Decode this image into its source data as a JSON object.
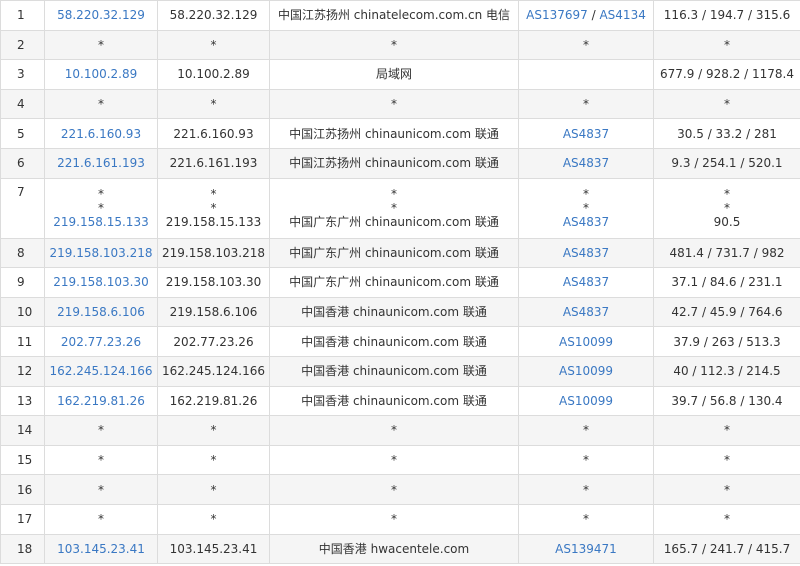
{
  "rows": [
    {
      "hop": "1",
      "ip_link": "58.220.32.129",
      "ip": "58.220.32.129",
      "location": "中国江苏扬州 chinatelecom.com.cn 电信",
      "as": [
        "AS137697",
        "AS4134"
      ],
      "times": "116.3 / 194.7 / 315.6"
    },
    {
      "hop": "2",
      "ip_link": "*",
      "ip": "*",
      "location": "*",
      "as": [
        "*"
      ],
      "times": "*"
    },
    {
      "hop": "3",
      "ip_link": "10.100.2.89",
      "ip": "10.100.2.89",
      "location": "局域网",
      "as": [],
      "times": "677.9 / 928.2 / 1178.4"
    },
    {
      "hop": "4",
      "ip_link": "*",
      "ip": "*",
      "location": "*",
      "as": [
        "*"
      ],
      "times": "*"
    },
    {
      "hop": "5",
      "ip_link": "221.6.160.93",
      "ip": "221.6.160.93",
      "location": "中国江苏扬州 chinaunicom.com 联通",
      "as": [
        "AS4837"
      ],
      "times": "30.5 / 33.2 / 281"
    },
    {
      "hop": "6",
      "ip_link": "221.6.161.193",
      "ip": "221.6.161.193",
      "location": "中国江苏扬州 chinaunicom.com 联通",
      "as": [
        "AS4837"
      ],
      "times": "9.3 / 254.1 / 520.1"
    },
    {
      "hop": "7",
      "multi": true,
      "ip_link_lines": [
        "*",
        "*",
        "219.158.15.133"
      ],
      "ip_lines": [
        "*",
        "*",
        "219.158.15.133"
      ],
      "location_lines": [
        "*",
        "*",
        "中国广东广州 chinaunicom.com 联通"
      ],
      "as_lines": [
        "*",
        "*",
        "AS4837"
      ],
      "times_lines": [
        "*",
        "*",
        "90.5"
      ]
    },
    {
      "hop": "8",
      "ip_link": "219.158.103.218",
      "ip": "219.158.103.218",
      "location": "中国广东广州 chinaunicom.com 联通",
      "as": [
        "AS4837"
      ],
      "times": "481.4 / 731.7 / 982"
    },
    {
      "hop": "9",
      "ip_link": "219.158.103.30",
      "ip": "219.158.103.30",
      "location": "中国广东广州 chinaunicom.com 联通",
      "as": [
        "AS4837"
      ],
      "times": "37.1 / 84.6 / 231.1"
    },
    {
      "hop": "10",
      "ip_link": "219.158.6.106",
      "ip": "219.158.6.106",
      "location": "中国香港 chinaunicom.com 联通",
      "as": [
        "AS4837"
      ],
      "times": "42.7 / 45.9 / 764.6"
    },
    {
      "hop": "11",
      "ip_link": "202.77.23.26",
      "ip": "202.77.23.26",
      "location": "中国香港 chinaunicom.com 联通",
      "as": [
        "AS10099"
      ],
      "times": "37.9 / 263 / 513.3"
    },
    {
      "hop": "12",
      "ip_link": "162.245.124.166",
      "ip": "162.245.124.166",
      "location": "中国香港 chinaunicom.com 联通",
      "as": [
        "AS10099"
      ],
      "times": "40 / 112.3 / 214.5"
    },
    {
      "hop": "13",
      "ip_link": "162.219.81.26",
      "ip": "162.219.81.26",
      "location": "中国香港 chinaunicom.com 联通",
      "as": [
        "AS10099"
      ],
      "times": "39.7 / 56.8 / 130.4"
    },
    {
      "hop": "14",
      "ip_link": "*",
      "ip": "*",
      "location": "*",
      "as": [
        "*"
      ],
      "times": "*"
    },
    {
      "hop": "15",
      "ip_link": "*",
      "ip": "*",
      "location": "*",
      "as": [
        "*"
      ],
      "times": "*"
    },
    {
      "hop": "16",
      "ip_link": "*",
      "ip": "*",
      "location": "*",
      "as": [
        "*"
      ],
      "times": "*"
    },
    {
      "hop": "17",
      "ip_link": "*",
      "ip": "*",
      "location": "*",
      "as": [
        "*"
      ],
      "times": "*"
    },
    {
      "hop": "18",
      "ip_link": "103.145.23.41",
      "ip": "103.145.23.41",
      "location": "中国香港 hwacentele.com",
      "as": [
        "AS139471"
      ],
      "times": "165.7 / 241.7 / 415.7"
    }
  ],
  "colors": {
    "link": "#3a78c3",
    "text": "#333333",
    "border": "#dcdcdc",
    "stripe": "#f5f5f5"
  }
}
